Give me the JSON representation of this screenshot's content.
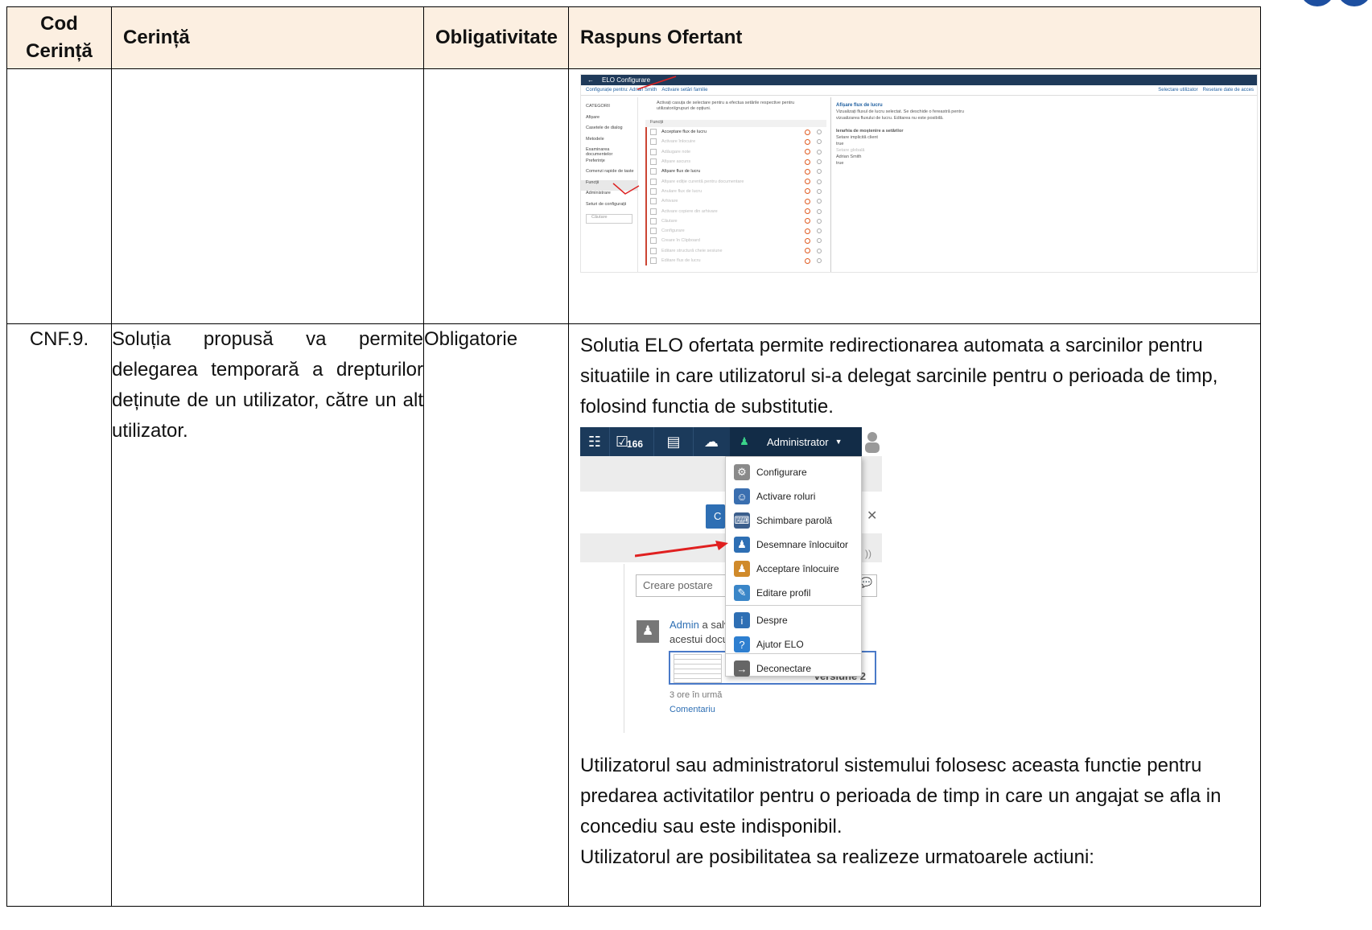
{
  "header": {
    "col1": "Cod Cerință",
    "col2": "Cerință",
    "col3": "Obligativitate",
    "col4": "Raspuns Ofertant"
  },
  "screenshot1": {
    "title": "ELO Configurare",
    "breadcrumb": "Configurație pentru: Adrian Smith",
    "breadcrumb_link": "Activare setări familie",
    "categories_label": "CATEGORII",
    "categories": [
      "Afișare",
      "Casetele de dialog",
      "Metodele",
      "Examinarea documentelor",
      "Preferințe",
      "Comenzi rapide de taste",
      "Funcții",
      "Administrare",
      "Seturi de configurații"
    ],
    "search_placeholder": "Căutare",
    "hint": "Activați casuța de selectare pentru a efectua setările respective pentru utilizatori/grupuri de opțiuni.",
    "functions_header": "Funcții",
    "functions": [
      {
        "label": "Acceptare flux de lucru",
        "dim": false
      },
      {
        "label": "Activare înlocuire",
        "dim": true
      },
      {
        "label": "Adăugare note",
        "dim": true
      },
      {
        "label": "Afișare ascuns",
        "dim": true
      },
      {
        "label": "Afișare flux de lucru",
        "dim": false
      },
      {
        "label": "Afișare ediție curentă pentru documentare",
        "dim": true
      },
      {
        "label": "Anulare flux de lucru",
        "dim": true
      },
      {
        "label": "Arhivare",
        "dim": true
      },
      {
        "label": "Activare copiere din arhivare",
        "dim": true
      },
      {
        "label": "Căutare",
        "dim": true
      },
      {
        "label": "Configurare",
        "dim": true
      },
      {
        "label": "Creare în Clipboard",
        "dim": true
      },
      {
        "label": "Editare structură cheie sesiune",
        "dim": true
      },
      {
        "label": "Editare flux de lucru",
        "dim": true
      }
    ],
    "right_title": "Afișare flux de lucru",
    "right_desc": "Vizualizați fluxul de lucru selectat. Se deschide o fereastră pentru vizualizarea fluxului de lucru. Editarea nu este posibilă.",
    "right_hier": "Ierarhia de moștenire a setărilor",
    "right_items": [
      "Setare implicită client",
      "true",
      "Setare globală",
      "Adrian Smith",
      "true"
    ],
    "top_right": [
      "Selectare utilizator",
      "Resetare date de acces"
    ]
  },
  "rows": [
    {
      "code": "CNF.9.",
      "requirement": "Soluția propusă va permite delegarea temporară a drepturilor deținute de un utilizator, către un alt utilizator.",
      "mandatory": "Obligatorie",
      "response_intro": "Solutia ELO ofertata permite redirectionarea automata a sarcinilor pentru situatiile in care utilizatorul si-a delegat sarcinile pentru o perioada de timp, folosind functia de substitutie.",
      "response_after": "Utilizatorul sau administratorul sistemului folosesc aceasta functie pentru predarea activitatilor pentru o perioada de timp in care un angajat se afla in concediu sau este indisponibil.",
      "response_last": "Utilizatorul are posibilitatea sa realizeze urmatoarele actiuni:"
    }
  ],
  "screenshot2": {
    "task_count": "166",
    "admin_label": "Administrator",
    "menu": [
      {
        "label": "Configurare",
        "color": "#8a8a8a",
        "glyph": "⚙"
      },
      {
        "label": "Activare roluri",
        "color": "#3a6fb0",
        "glyph": "☺"
      },
      {
        "label": "Schimbare parolă",
        "color": "#3b5e8c",
        "glyph": "⌨"
      },
      {
        "label": "Desemnare înlocuitor",
        "color": "#2e6fb4",
        "glyph": "♟"
      },
      {
        "label": "Acceptare înlocuire",
        "color": "#d08a2a",
        "glyph": "♟"
      },
      {
        "label": "Editare profil",
        "color": "#3a86c8",
        "glyph": "✎"
      },
      {
        "label": "Despre",
        "color": "#2e6fb4",
        "glyph": "i"
      },
      {
        "label": "Ajutor ELO",
        "color": "#2e7fd0",
        "glyph": "?"
      },
      {
        "label": "Deconectare",
        "color": "#666666",
        "glyph": "→"
      }
    ],
    "input_placeholder": "Creare postare",
    "blue_button": "C",
    "post_user": "Admin",
    "post_text1": " a salv",
    "post_text2": "acestui docu",
    "card_label": "Versiune 2",
    "post_time": "3 ore în urmă",
    "post_comment": "Comentariu"
  }
}
